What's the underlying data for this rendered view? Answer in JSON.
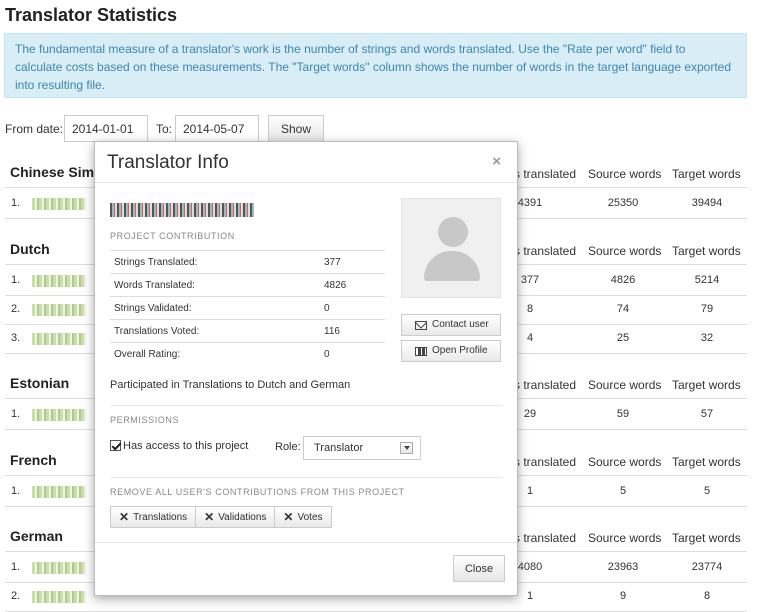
{
  "page": {
    "title": "Translator Statistics",
    "info": "The fundamental measure of a translator's work is the number of strings and words translated. Use the \"Rate per word\" field to calculate costs based on these measurements. The \"Target words\" column shows the number of words in the target language exported into resulting file."
  },
  "filter": {
    "from_label": "From date:",
    "from_value": "2014-01-01",
    "to_label": "To:",
    "to_value": "2014-05-07",
    "show_label": "Show"
  },
  "columns": {
    "strings_translated": "s translated",
    "source_words": "Source words",
    "target_words": "Target words"
  },
  "languages": [
    {
      "name": "Chinese Simp",
      "rows": [
        {
          "rank": "1.",
          "strings": "4391",
          "source": "25350",
          "target": "39494"
        }
      ]
    },
    {
      "name": "Dutch",
      "rows": [
        {
          "rank": "1.",
          "strings": "377",
          "source": "4826",
          "target": "5214"
        },
        {
          "rank": "2.",
          "strings": "8",
          "source": "74",
          "target": "79"
        },
        {
          "rank": "3.",
          "strings": "4",
          "source": "25",
          "target": "32"
        }
      ]
    },
    {
      "name": "Estonian",
      "rows": [
        {
          "rank": "1.",
          "strings": "29",
          "source": "59",
          "target": "57"
        }
      ]
    },
    {
      "name": "French",
      "rows": [
        {
          "rank": "1.",
          "strings": "1",
          "source": "5",
          "target": "5"
        }
      ]
    },
    {
      "name": "German",
      "rows": [
        {
          "rank": "1.",
          "strings": "4080",
          "source": "23963",
          "target": "23774"
        },
        {
          "rank": "2.",
          "strings": "1",
          "source": "9",
          "target": "8"
        }
      ]
    }
  ],
  "modal": {
    "title": "Translator Info",
    "close_symbol": "×",
    "project_contribution_label": "PROJECT CONTRIBUTION",
    "stats": [
      {
        "label": "Strings Translated:",
        "value": "377"
      },
      {
        "label": "Words Translated:",
        "value": "4826"
      },
      {
        "label": "Strings Validated:",
        "value": "0"
      },
      {
        "label": "Translations Voted:",
        "value": "116"
      },
      {
        "label": "Overall Rating:",
        "value": "0"
      }
    ],
    "contact_label": "Contact user",
    "profile_label": "Open Profile",
    "participated": "Participated in Translations to Dutch and German",
    "permissions_label": "PERMISSIONS",
    "access_label": "Has access to this project",
    "access_checked": true,
    "role_label": "Role:",
    "role_value": "Translator",
    "remove_label": "REMOVE ALL USER'S CONTRIBUTIONS FROM THIS PROJECT",
    "remove_buttons": [
      "Translations",
      "Validations",
      "Votes"
    ],
    "close_button": "Close"
  }
}
